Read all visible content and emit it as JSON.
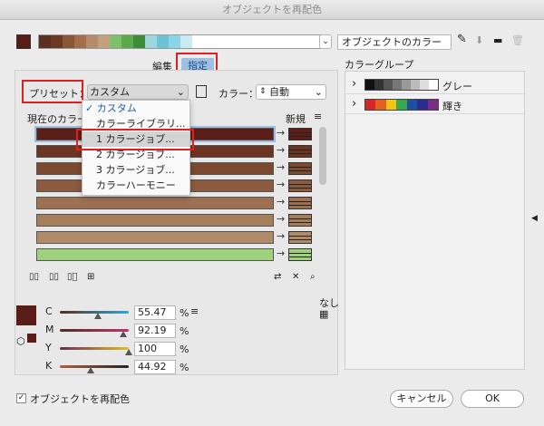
{
  "window": {
    "title": "オブジェクトを再配色"
  },
  "swatches": {
    "colors": [
      "#5a2e23",
      "#6a3a27",
      "#8a5637",
      "#a36d4e",
      "#b58c6a",
      "#c3a17f",
      "#7dbf6a",
      "#5ba94a",
      "#3e8c3a",
      "#9fd6de",
      "#6cc3d4",
      "#8ad6e6",
      "#c9ebf1"
    ]
  },
  "artwork_color": "#5a1c17",
  "name_field": "オブジェクトのカラー",
  "tabs": {
    "edit": "編集",
    "assign": "指定"
  },
  "preset": {
    "label": "プリセット：",
    "value": "カスタム"
  },
  "color_mode": {
    "label": "カラー：",
    "value": "自動"
  },
  "columns": {
    "current": "現在のカラー",
    "new": "新規"
  },
  "rows": [
    {
      "current": "#5c1e18",
      "new": "#5c1e18"
    },
    {
      "current": "#6b3522",
      "new": "#6b3522"
    },
    {
      "current": "#7b4a30",
      "new": "#7b4a30"
    },
    {
      "current": "#8c5a3e",
      "new": "#8c5a3e"
    },
    {
      "current": "#9c7050",
      "new": "#9c7050"
    },
    {
      "current": "#a77e5a",
      "new": "#a77e5a"
    },
    {
      "current": "#b08b67",
      "new": "#b08b67"
    },
    {
      "current": "#9fd17a",
      "new": "#9fd17a"
    }
  ],
  "preset_menu": {
    "items": [
      "カスタム",
      "カラーライブラリ...",
      "1 カラージョブ...",
      "2 カラージョブ...",
      "3 カラージョブ...",
      "カラーハーモニー"
    ],
    "checked": "カスタム",
    "highlighted": "1 カラージョブ..."
  },
  "groups": {
    "title": "カラーグループ",
    "items": [
      {
        "name": "グレー",
        "colors": [
          "#111",
          "#333",
          "#555",
          "#777",
          "#999",
          "#bbb",
          "#ddd",
          "#fff"
        ]
      },
      {
        "name": "輝き",
        "colors": [
          "#d7262a",
          "#e55f1f",
          "#f3c317",
          "#39a84a",
          "#1f4fa3",
          "#2c2b8f",
          "#7c2c84"
        ]
      }
    ]
  },
  "cmyk": [
    {
      "label": "C",
      "value": "55.47",
      "unit": "%",
      "thumb": 0.55
    },
    {
      "label": "M",
      "value": "92.19",
      "unit": "%",
      "thumb": 0.92
    },
    {
      "label": "Y",
      "value": "100",
      "unit": "%",
      "thumb": 1.0
    },
    {
      "label": "K",
      "value": "44.92",
      "unit": "%",
      "thumb": 0.45
    }
  ],
  "none_label": "なし",
  "footer": {
    "recolor": "オブジェクトを再配色",
    "cancel": "キャンセル",
    "ok": "OK"
  }
}
